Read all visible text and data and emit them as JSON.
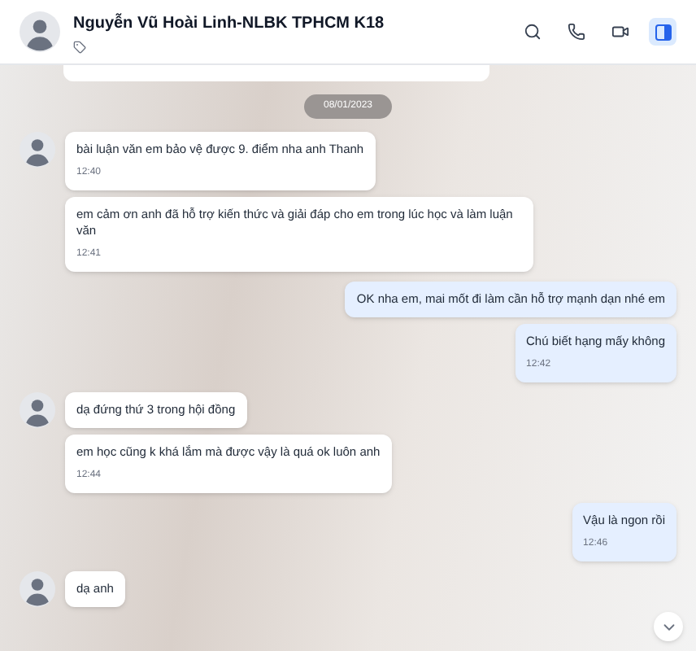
{
  "header": {
    "title": "Nguyễn Vũ Hoài Linh-NLBK TPHCM K18",
    "sidebar_toggle": {
      "selected": true
    }
  },
  "date_divider": "08/01/2023",
  "messages": [
    {
      "kind": "received",
      "avatar": true,
      "text": "bài luận văn em bảo vệ được 9. điểm nha anh Thanh",
      "time": "12:40"
    },
    {
      "kind": "received",
      "avatar": false,
      "text": "em cảm ơn anh đã hỗ trợ kiến thức và giải đáp cho em trong lúc học và làm luận văn",
      "time": "12:41"
    },
    {
      "kind": "sent",
      "text": "OK nha em, mai mốt đi làm cần hỗ trợ mạnh dạn nhé em"
    },
    {
      "kind": "sent",
      "text": "Chú biết hạng mấy không",
      "time": "12:42"
    },
    {
      "kind": "received",
      "avatar": true,
      "text": "dạ đứng thứ 3 trong hội đồng"
    },
    {
      "kind": "received",
      "avatar": false,
      "text": "em học cũng k khá lắm mà được vậy là quá ok luôn anh",
      "time": "12:44"
    },
    {
      "kind": "sent",
      "text": "Vậu là ngon rồi",
      "time": "12:46"
    },
    {
      "kind": "received",
      "avatar": true,
      "text": "dạ anh"
    }
  ]
}
